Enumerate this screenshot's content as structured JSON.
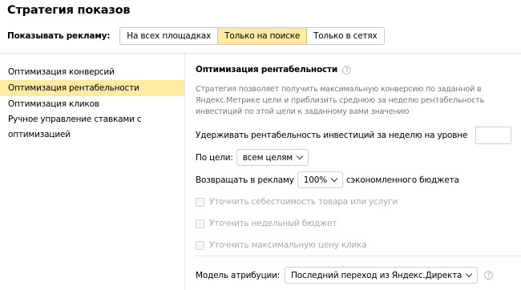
{
  "page": {
    "title": "Стратегия показов"
  },
  "show_ads": {
    "label": "Показывать рекламу:",
    "options": [
      {
        "label": "На всех площадках",
        "active": false
      },
      {
        "label": "Только на поиске",
        "active": true
      },
      {
        "label": "Только в сетях",
        "active": false
      }
    ]
  },
  "sidebar": {
    "items": [
      {
        "label": "Оптимизация конверсий",
        "active": false
      },
      {
        "label": "Оптимизация рентабельности",
        "active": true
      },
      {
        "label": "Оптимизация кликов",
        "active": false
      },
      {
        "label": "Ручное управление ставками с оптимизацией",
        "active": false
      }
    ]
  },
  "main": {
    "section_title": "Оптимизация рентабельности",
    "help_icon": "question-icon",
    "description": "Стратегия позволяет получить максимальную конверсию по заданной в Яндекс.Метрике цели и приблизить среднюю за неделю рентабельность инвестиций по этой цели к заданному вами значению",
    "roi_label": "Удерживать рентабельность инвестиций за неделю на уровне",
    "roi_value": "",
    "goal_label": "По цели:",
    "goal_value": "всем целям",
    "reinvest_label": "Возвращать в рекламу",
    "reinvest_value": "100%",
    "reinvest_suffix": "сэкономленного бюджета",
    "checkboxes": [
      {
        "label": "Уточнить себестоимость товара или услуги",
        "checked": false,
        "disabled": true
      },
      {
        "label": "Уточнить недельный бюджет",
        "checked": false,
        "disabled": true
      },
      {
        "label": "Уточнить максимальную цену клика",
        "checked": false,
        "disabled": true
      }
    ],
    "attribution_label": "Модель атрибуции:",
    "attribution_value": "Последний переход из Яндекс.Директа"
  },
  "colors": {
    "accent": "#ffeba0",
    "muted_text": "#777777",
    "disabled_text": "#a9a9a9"
  }
}
